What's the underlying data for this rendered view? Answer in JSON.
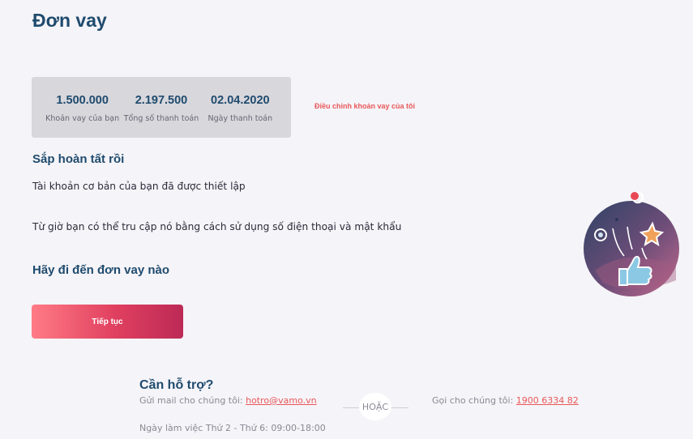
{
  "page": {
    "title": "Đơn vay"
  },
  "summary": {
    "loan_amount": {
      "value": "1.500.000",
      "label": "Khoản vay của bạn"
    },
    "total_payment": {
      "value": "2.197.500",
      "label": "Tổng số thanh toán"
    },
    "payment_date": {
      "value": "02.04.2020",
      "label": "Ngày thanh toán"
    }
  },
  "adjust_link": "Điều chỉnh khoản vay của tôi",
  "content": {
    "subtitle": "Sắp hoàn tất rồi",
    "paragraph1": "Tài khoản cơ bản của bạn đã được thiết lập",
    "paragraph2": "Từ giờ bạn có thể tru cập nó bằng cách sử dụng số điện thoại và mật khẩu",
    "cta_heading": "Hãy đi đến đơn vay nào",
    "continue_label": "Tiếp tục"
  },
  "help": {
    "title": "Cần hỗ trợ?",
    "mail_prefix": "Gửi mail cho chúng tôi: ",
    "email": "hotro@vamo.vn",
    "or_label": "HOẶC",
    "phone_prefix": "Gọi cho chúng tôi: ",
    "phone": "1900 6334 82",
    "hours": "Ngày làm việc Thứ 2 - Thứ 6: 09:00-18:00"
  },
  "colors": {
    "heading": "#1f4b6e",
    "accent": "#e8585a",
    "button_start": "#ff7b86",
    "button_end": "#bc2a56",
    "background": "#f5f4f8"
  },
  "icons": {
    "illustration": "thumbs-up-planet-icon"
  }
}
